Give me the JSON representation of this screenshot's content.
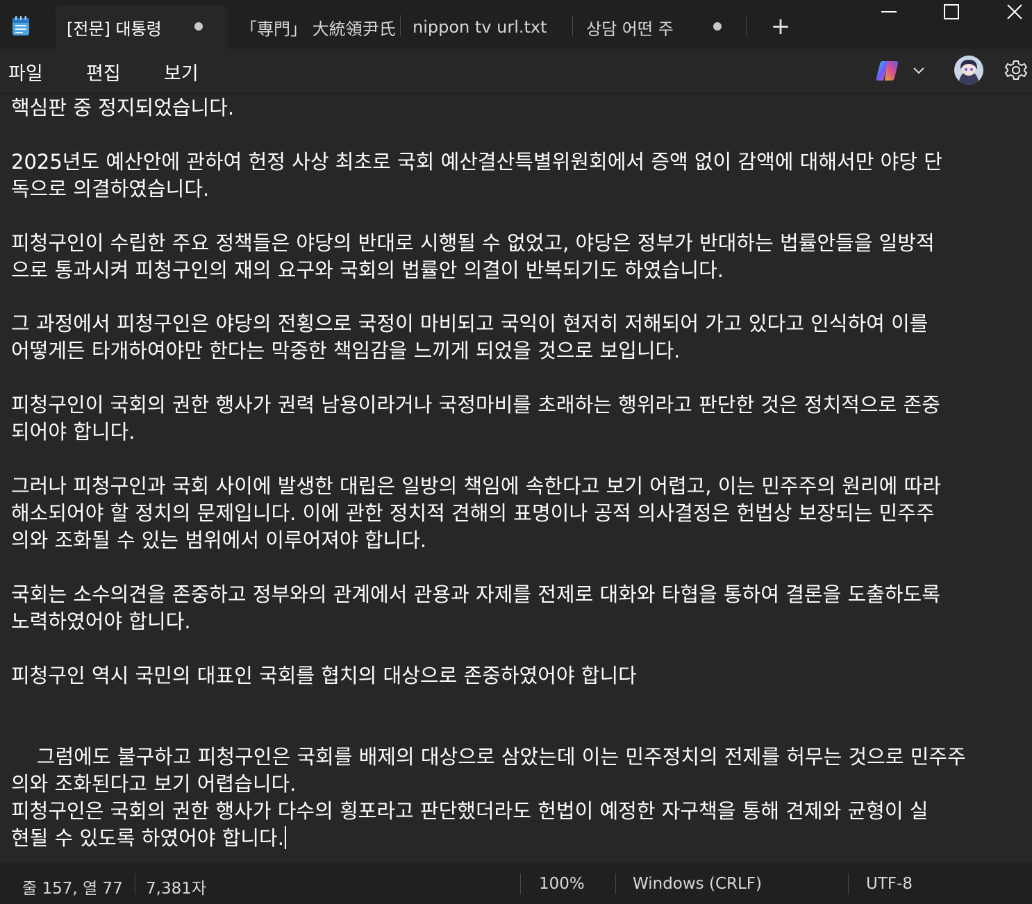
{
  "tabs": [
    {
      "label": "[전문] 대통령 ",
      "modified": true,
      "active": true
    },
    {
      "label": "「専門」 大統領尹氏",
      "modified": false,
      "active": false
    },
    {
      "label": "nippon tv url.txt",
      "modified": false,
      "active": false
    },
    {
      "label": "상담  어떤 주",
      "modified": true,
      "active": false
    }
  ],
  "new_tab_label": "+",
  "menu": {
    "file": "파일",
    "edit": "편집",
    "view": "보기"
  },
  "icons": {
    "app": "notepad-icon",
    "copilot": "copilot-icon",
    "settings": "gear-icon"
  },
  "content": {
    "paragraphs": [
      "핵심판 중 정지되었습니다.",
      "2025년도 예산안에 관하여 헌정 사상 최초로 국회 예산결산특별위원회에서 증액 없이 감액에 대해서만 야당 단\n독으로 의결하였습니다.",
      "피청구인이 수립한 주요 정책들은 야당의 반대로 시행될 수 없었고, 야당은 정부가 반대하는 법률안들을 일방적\n으로 통과시켜 피청구인의 재의 요구와 국회의 법률안 의결이 반복되기도 하였습니다.",
      "그 과정에서 피청구인은 야당의 전횡으로 국정이 마비되고 국익이 현저히 저해되어 가고 있다고 인식하여 이를\n어떻게든 타개하여야만 한다는 막중한 책임감을 느끼게 되었을 것으로 보입니다.",
      "피청구인이 국회의 권한 행사가 권력 남용이라거나 국정마비를 초래하는 행위라고 판단한 것은 정치적으로 존중\n되어야 합니다.",
      "그러나 피청구인과 국회 사이에 발생한 대립은 일방의 책임에 속한다고 보기 어렵고, 이는 민주주의 원리에 따라\n해소되어야 할 정치의 문제입니다. 이에 관한 정치적 견해의 표명이나 공적 의사결정은 헌법상 보장되는 민주주\n의와 조화될 수 있는 범위에서 이루어져야 합니다.",
      "국회는 소수의견을 존중하고 정부와의 관계에서 관용과 자제를 전제로 대화와 타협을 통하여 결론을 도출하도록\n노력하였어야 합니다.",
      "피청구인 역시 국민의 대표인 국회를 협치의 대상으로 존중하였어야 합니다",
      "그럼에도 불구하고 피청구인은 국회를 배제의 대상으로 삼았는데 이는 민주정치의 전제를 허무는 것으로 민주주\n의와 조화된다고 보기 어렵습니다.",
      "피청구인은 국회의 권한 행사가 다수의 횡포라고 판단했더라도 헌법이 예정한 자구책을 통해 견제와 균형이 실\n현될 수 있도록 하였어야 합니다."
    ]
  },
  "status": {
    "position": "줄 157, 열 77",
    "char_count": "7,381자",
    "zoom": "100%",
    "line_ending": "Windows (CRLF)",
    "encoding": "UTF-8"
  },
  "colors": {
    "titlebar_bg": "#202020",
    "editor_bg": "#272727",
    "text": "#ffffff",
    "status_text": "#d8d8d8"
  }
}
